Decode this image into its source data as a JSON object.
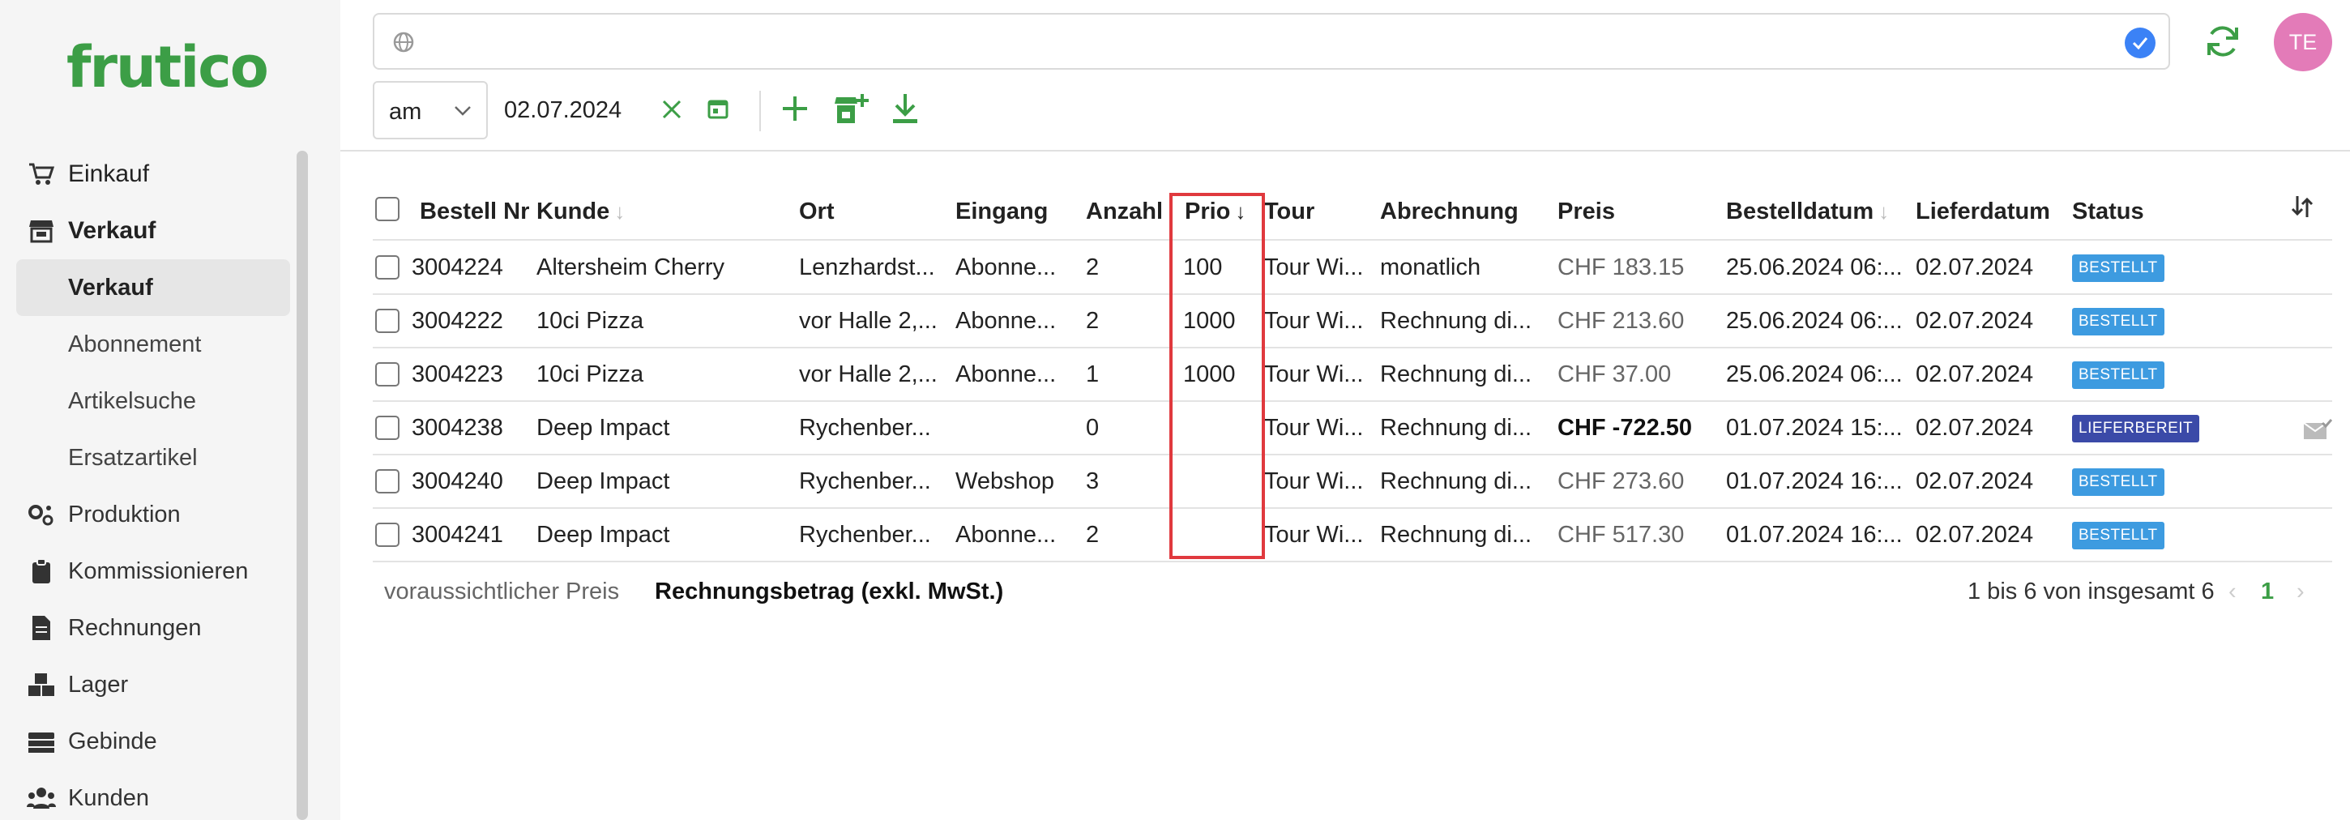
{
  "app": {
    "logo": "frutico"
  },
  "sidebar": {
    "items": [
      {
        "label": "Einkauf",
        "icon": "cart-icon",
        "kind": "main"
      },
      {
        "label": "Verkauf",
        "icon": "store-icon",
        "kind": "main"
      },
      {
        "label": "Verkauf",
        "kind": "active"
      },
      {
        "label": "Abonnement",
        "kind": "sub"
      },
      {
        "label": "Artikelsuche",
        "kind": "sub"
      },
      {
        "label": "Ersatzartikel",
        "kind": "sub"
      },
      {
        "label": "Produktion",
        "icon": "gears-icon",
        "kind": "main"
      },
      {
        "label": "Kommissionieren",
        "icon": "clipboard-icon",
        "kind": "main"
      },
      {
        "label": "Rechnungen",
        "icon": "invoice-icon",
        "kind": "main"
      },
      {
        "label": "Lager",
        "icon": "boxes-icon",
        "kind": "main"
      },
      {
        "label": "Gebinde",
        "icon": "crates-icon",
        "kind": "main"
      },
      {
        "label": "Kunden",
        "icon": "users-icon",
        "kind": "main"
      }
    ]
  },
  "topbar": {
    "search_value": "",
    "avatar_initials": "TE",
    "colors": {
      "accent": "#3c9e46",
      "avatar": "#e37bb8",
      "check": "#3b82f6"
    }
  },
  "toolbar": {
    "date_mode": "am",
    "date_value": "02.07.2024"
  },
  "table": {
    "headers": {
      "bestellnr": "Bestell Nr",
      "kunde": "Kunde",
      "ort": "Ort",
      "eingang": "Eingang",
      "anzahl": "Anzahl",
      "prio": "Prio",
      "tour": "Tour",
      "abrechnung": "Abrechnung",
      "preis": "Preis",
      "bestelldatum": "Bestelldatum",
      "lieferdatum": "Lieferdatum",
      "status": "Status"
    },
    "rows": [
      {
        "nr": "3004224",
        "kunde": "Altersheim Cherry",
        "ort": "Lenzhardst...",
        "eingang": "Abonne...",
        "anzahl": "2",
        "prio": "100",
        "tour": "Tour Wi...",
        "abrechnung": "monatlich",
        "preis": "CHF 183.15",
        "preis_bold": false,
        "bestelldatum": "25.06.2024 06:...",
        "lieferdatum": "02.07.2024",
        "status": "BESTELLT",
        "status_color": "#3d9be0",
        "mail": false
      },
      {
        "nr": "3004222",
        "kunde": "10ci Pizza",
        "ort": "vor Halle 2,...",
        "eingang": "Abonne...",
        "anzahl": "2",
        "prio": "1000",
        "tour": "Tour Wi...",
        "abrechnung": "Rechnung di...",
        "preis": "CHF 213.60",
        "preis_bold": false,
        "bestelldatum": "25.06.2024 06:...",
        "lieferdatum": "02.07.2024",
        "status": "BESTELLT",
        "status_color": "#3d9be0",
        "mail": false
      },
      {
        "nr": "3004223",
        "kunde": "10ci Pizza",
        "ort": "vor Halle 2,...",
        "eingang": "Abonne...",
        "anzahl": "1",
        "prio": "1000",
        "tour": "Tour Wi...",
        "abrechnung": "Rechnung di...",
        "preis": "CHF 37.00",
        "preis_bold": false,
        "bestelldatum": "25.06.2024 06:...",
        "lieferdatum": "02.07.2024",
        "status": "BESTELLT",
        "status_color": "#3d9be0",
        "mail": false
      },
      {
        "nr": "3004238",
        "kunde": "Deep Impact",
        "ort": "Rychenber...",
        "eingang": "",
        "anzahl": "0",
        "prio": "",
        "tour": "Tour Wi...",
        "abrechnung": "Rechnung di...",
        "preis": "CHF -722.50",
        "preis_bold": true,
        "bestelldatum": "01.07.2024 15:...",
        "lieferdatum": "02.07.2024",
        "status": "LIEFERBEREIT",
        "status_color": "#3b4aa8",
        "mail": true
      },
      {
        "nr": "3004240",
        "kunde": "Deep Impact",
        "ort": "Rychenber...",
        "eingang": "Webshop",
        "anzahl": "3",
        "prio": "",
        "tour": "Tour Wi...",
        "abrechnung": "Rechnung di...",
        "preis": "CHF 273.60",
        "preis_bold": false,
        "bestelldatum": "01.07.2024 16:...",
        "lieferdatum": "02.07.2024",
        "status": "BESTELLT",
        "status_color": "#3d9be0",
        "mail": false
      },
      {
        "nr": "3004241",
        "kunde": "Deep Impact",
        "ort": "Rychenber...",
        "eingang": "Abonne...",
        "anzahl": "2",
        "prio": "",
        "tour": "Tour Wi...",
        "abrechnung": "Rechnung di...",
        "preis": "CHF 517.30",
        "preis_bold": false,
        "bestelldatum": "01.07.2024 16:...",
        "lieferdatum": "02.07.2024",
        "status": "BESTELLT",
        "status_color": "#3d9be0",
        "mail": false
      }
    ]
  },
  "footer": {
    "legend_estimated": "voraussichtlicher Preis",
    "legend_invoice": "Rechnungsbetrag (exkl. MwSt.)",
    "pagination_text": "1 bis 6 von insgesamt 6",
    "current_page": "1"
  }
}
